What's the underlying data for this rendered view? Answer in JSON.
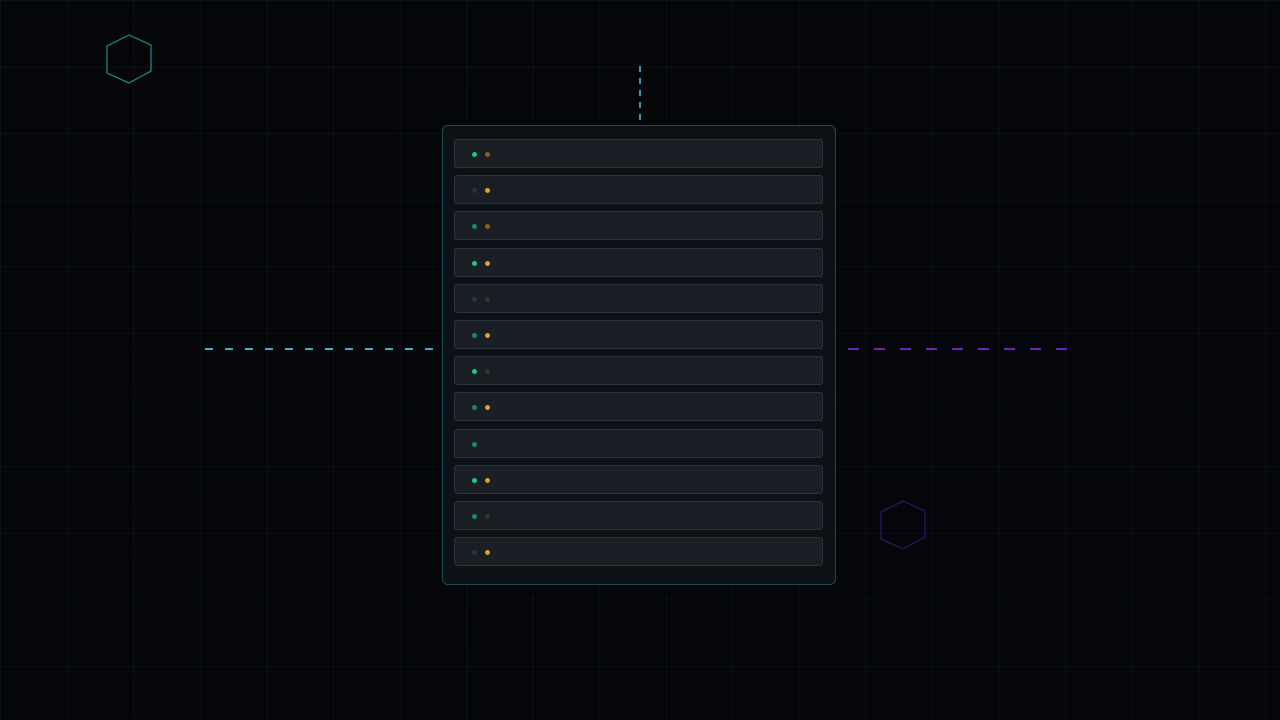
{
  "scene": {
    "colors": {
      "background": "#04060a",
      "panel_border": "#1d4a52",
      "row_fill": "#1a1f26",
      "accent_cyan": "#39c6da",
      "accent_purple": "#7a24d8",
      "status_green_on": "#22c87a",
      "status_amber_on": "#e0a020"
    }
  },
  "list": {
    "rows": [
      {
        "green": "bright",
        "amber": "dim"
      },
      {
        "green": "off",
        "amber": "bright"
      },
      {
        "green": "mid",
        "amber": "dim"
      },
      {
        "green": "bright",
        "amber": "bright"
      },
      {
        "green": "off",
        "amber": "off"
      },
      {
        "green": "mid",
        "amber": "bright"
      },
      {
        "green": "bright",
        "amber": "off"
      },
      {
        "green": "mid",
        "amber": "bright"
      },
      {
        "green": "mid",
        "amber": "none"
      },
      {
        "green": "bright",
        "amber": "bright"
      },
      {
        "green": "mid",
        "amber": "off"
      },
      {
        "green": "off",
        "amber": "bright"
      }
    ]
  }
}
